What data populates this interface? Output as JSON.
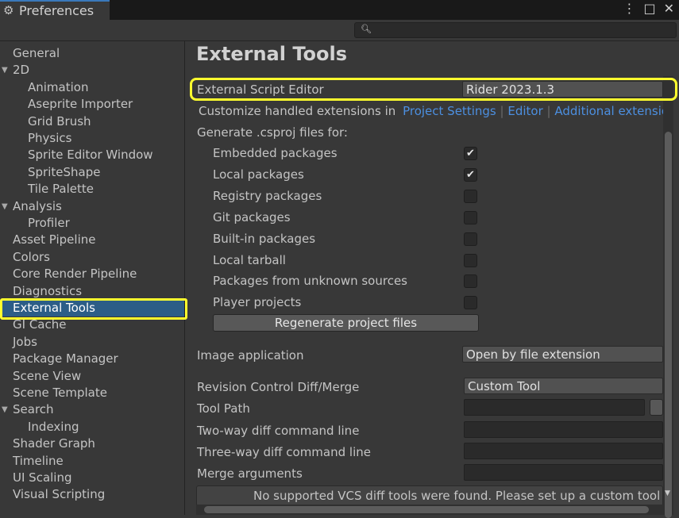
{
  "window": {
    "title": "Preferences",
    "buttons": [
      "⋮",
      "□",
      "✕"
    ]
  },
  "sidebar": {
    "items": [
      {
        "label": "General",
        "indent": 0,
        "expandable": false,
        "selected": false
      },
      {
        "label": "2D",
        "indent": 0,
        "expandable": true,
        "selected": false
      },
      {
        "label": "Animation",
        "indent": 1,
        "expandable": false,
        "selected": false
      },
      {
        "label": "Aseprite Importer",
        "indent": 1,
        "expandable": false,
        "selected": false
      },
      {
        "label": "Grid Brush",
        "indent": 1,
        "expandable": false,
        "selected": false
      },
      {
        "label": "Physics",
        "indent": 1,
        "expandable": false,
        "selected": false
      },
      {
        "label": "Sprite Editor Window",
        "indent": 1,
        "expandable": false,
        "selected": false
      },
      {
        "label": "SpriteShape",
        "indent": 1,
        "expandable": false,
        "selected": false
      },
      {
        "label": "Tile Palette",
        "indent": 1,
        "expandable": false,
        "selected": false
      },
      {
        "label": "Analysis",
        "indent": 0,
        "expandable": true,
        "selected": false
      },
      {
        "label": "Profiler",
        "indent": 1,
        "expandable": false,
        "selected": false
      },
      {
        "label": "Asset Pipeline",
        "indent": 0,
        "expandable": false,
        "selected": false
      },
      {
        "label": "Colors",
        "indent": 0,
        "expandable": false,
        "selected": false
      },
      {
        "label": "Core Render Pipeline",
        "indent": 0,
        "expandable": false,
        "selected": false
      },
      {
        "label": "Diagnostics",
        "indent": 0,
        "expandable": false,
        "selected": false
      },
      {
        "label": "External Tools",
        "indent": 0,
        "expandable": false,
        "selected": true
      },
      {
        "label": "GI Cache",
        "indent": 0,
        "expandable": false,
        "selected": false
      },
      {
        "label": "Jobs",
        "indent": 0,
        "expandable": false,
        "selected": false
      },
      {
        "label": "Package Manager",
        "indent": 0,
        "expandable": false,
        "selected": false
      },
      {
        "label": "Scene View",
        "indent": 0,
        "expandable": false,
        "selected": false
      },
      {
        "label": "Scene Template",
        "indent": 0,
        "expandable": false,
        "selected": false
      },
      {
        "label": "Search",
        "indent": 0,
        "expandable": true,
        "selected": false
      },
      {
        "label": "Indexing",
        "indent": 1,
        "expandable": false,
        "selected": false
      },
      {
        "label": "Shader Graph",
        "indent": 0,
        "expandable": false,
        "selected": false
      },
      {
        "label": "Timeline",
        "indent": 0,
        "expandable": false,
        "selected": false
      },
      {
        "label": "UI Scaling",
        "indent": 0,
        "expandable": false,
        "selected": false
      },
      {
        "label": "Visual Scripting",
        "indent": 0,
        "expandable": false,
        "selected": false
      }
    ]
  },
  "main": {
    "title": "External Tools",
    "script_editor": {
      "label": "External Script Editor",
      "value": "Rider 2023.1.3"
    },
    "extensions": {
      "label": "Customize handled extensions in",
      "links": [
        "Project Settings",
        "Editor",
        "Additional extensio"
      ]
    },
    "csproj_label": "Generate .csproj files for:",
    "packages": [
      {
        "label": "Embedded packages",
        "checked": true
      },
      {
        "label": "Local packages",
        "checked": true
      },
      {
        "label": "Registry packages",
        "checked": false
      },
      {
        "label": "Git packages",
        "checked": false
      },
      {
        "label": "Built-in packages",
        "checked": false
      },
      {
        "label": "Local tarball",
        "checked": false
      },
      {
        "label": "Packages from unknown sources",
        "checked": false
      },
      {
        "label": "Player projects",
        "checked": false
      }
    ],
    "regenerate_label": "Regenerate project files",
    "image_app": {
      "label": "Image application",
      "value": "Open by file extension"
    },
    "revision": {
      "label": "Revision Control Diff/Merge",
      "value": "Custom Tool"
    },
    "tool_path_label": "Tool Path",
    "two_way_label": "Two-way diff command line",
    "three_way_label": "Three-way diff command line",
    "merge_label": "Merge arguments",
    "vcs_message": "No supported VCS diff tools were found. Please set up a custom tool o"
  },
  "colors": {
    "highlight": "#ffff2e",
    "selection": "#2c5d87",
    "link": "#4c8fe0"
  }
}
